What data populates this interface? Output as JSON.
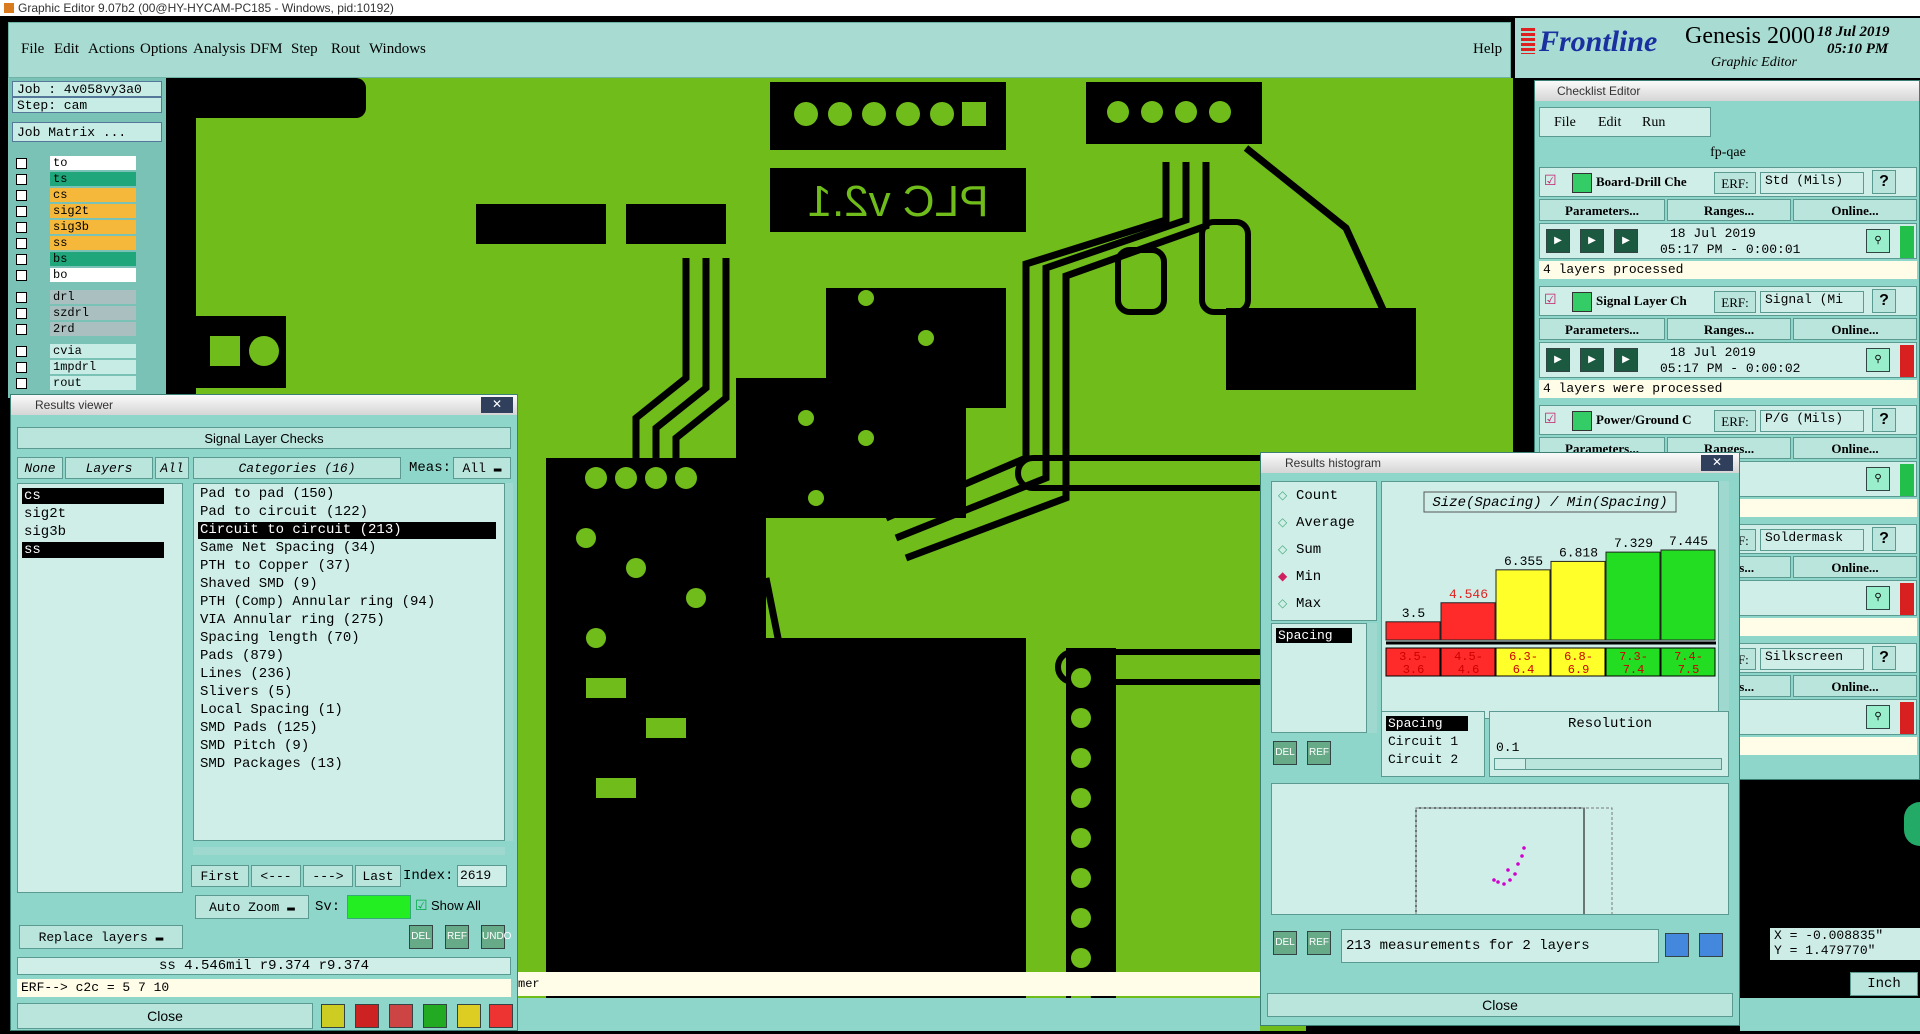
{
  "window_title": "Graphic Editor 9.07b2 (00@HY-HYCAM-PC185 - Windows, pid:10192)",
  "menu": [
    "File",
    "Edit",
    "Actions",
    "Options",
    "Analysis",
    "DFM",
    "Step",
    "Rout",
    "Windows"
  ],
  "help_label": "Help",
  "brand": {
    "logo": "Frontline",
    "product": "Genesis 2000",
    "subtitle": "Graphic Editor",
    "date": "18 Jul 2019",
    "time": "05:10 PM"
  },
  "job": {
    "job": "Job : 4v058vy3a0",
    "step": "Step: cam",
    "matrix": "Job Matrix ..."
  },
  "layers": [
    {
      "name": "to",
      "color": "#ffffff"
    },
    {
      "name": "ts",
      "color": "#1fa67a"
    },
    {
      "name": "cs",
      "color": "#f5b83a"
    },
    {
      "name": "sig2t",
      "color": "#f5b83a"
    },
    {
      "name": "sig3b",
      "color": "#f5b83a"
    },
    {
      "name": "ss",
      "color": "#f5b83a"
    },
    {
      "name": "bs",
      "color": "#1fa67a"
    },
    {
      "name": "bo",
      "color": "#ffffff"
    },
    {
      "name": "drl",
      "color": "#aac0c0"
    },
    {
      "name": "szdrl",
      "color": "#aac0c0"
    },
    {
      "name": "2rd",
      "color": "#aac0c0"
    },
    {
      "name": "cvia",
      "color": "#c6ece5"
    },
    {
      "name": "1mpdrl",
      "color": "#c6ece5"
    },
    {
      "name": "rout",
      "color": "#c6ece5"
    }
  ],
  "board_text": "PLC v2.1",
  "results_viewer": {
    "title": "Results viewer",
    "header": "Signal Layer Checks",
    "none": "None",
    "layers": "Layers",
    "all": "All",
    "categories_label": "Categories (16)",
    "meas_label": "Meas:",
    "meas_value": "All",
    "layer_list": [
      "cs",
      "sig2t",
      "sig3b",
      "ss"
    ],
    "categories": [
      "Pad to pad (150)",
      "Pad to circuit (122)",
      "Circuit to circuit (213)",
      "Same Net Spacing (34)",
      "PTH to Copper (37)",
      "Shaved SMD (9)",
      "PTH (Comp) Annular ring (94)",
      "VIA Annular ring (275)",
      "Spacing length (70)",
      "Pads (879)",
      "Lines (236)",
      "Slivers (5)",
      "Local Spacing (1)",
      "SMD Pads (125)",
      "SMD Pitch (9)",
      "SMD Packages (13)"
    ],
    "first": "First",
    "prev": "<---",
    "next": "--->",
    "last": "Last",
    "index_label": "Index:",
    "index_value": "2619",
    "auto_zoom": "Auto Zoom",
    "sv_label": "Sv:",
    "show_all": "Show All",
    "replace_layers": "Replace layers",
    "del": "DEL",
    "ref": "REF",
    "undo": "UNDO",
    "status": "ss 4.546mil  r9.374  r9.374",
    "erf": "ERF--> c2c = 5 7 10",
    "close": "Close"
  },
  "checklist": {
    "title": "Checklist Editor",
    "menu": [
      "File",
      "Edit",
      "Run"
    ],
    "name": "fp-qae",
    "param": "Parameters...",
    "ranges": "Ranges...",
    "online": "Online...",
    "erf": "ERF:",
    "items": [
      {
        "name": "Board-Drill Che",
        "erf": "Std (Mils)",
        "date": "18 Jul 2019",
        "time": "05:17 PM - 0:00:01",
        "status": "4 layers processed",
        "state": "#22c04a"
      },
      {
        "name": "Signal Layer Ch",
        "erf": "Signal (Mi",
        "date": "18 Jul 2019",
        "time": "05:17 PM - 0:00:02",
        "status": "4 layers were processed",
        "state": "#d82020"
      },
      {
        "name": "Power/Ground C",
        "erf": "P/G (Mils)",
        "date": "2019",
        "time": "0:00:01",
        "status": "processed",
        "state": "#22c04a"
      },
      {
        "name": "",
        "erf": "Soldermask",
        "date": "2019",
        "time": "0:00:01",
        "status": "ere processed",
        "state": "#d82020"
      },
      {
        "name": "",
        "erf": "Silkscreen",
        "date": "2019",
        "time": "0:00:02",
        "status": "rocessed",
        "state": "#d82020"
      }
    ]
  },
  "histogram": {
    "title": "Results histogram",
    "modes": [
      "Count",
      "Average",
      "Sum",
      "Min",
      "Max"
    ],
    "selected_mode": "Min",
    "list_item": "Spacing",
    "chart_title": "Size(Spacing) / Min(Spacing)",
    "resolution_label": "Resolution",
    "resolution_value": "0.1",
    "measure_list": [
      "Spacing",
      "Circuit 1",
      "Circuit 2"
    ],
    "summary": "213 measurements for 2 layers",
    "close": "Close",
    "del": "DEL",
    "ref": "REF"
  },
  "chart_data": {
    "type": "bar",
    "title": "Size(Spacing) / Min(Spacing)",
    "categories": [
      "3.5-3.6",
      "4.5-4.6",
      "6.3-6.4",
      "6.8-6.9",
      "7.3-7.4",
      "7.4-7.5"
    ],
    "values": [
      3.5,
      4.546,
      6.355,
      6.818,
      7.329,
      7.445
    ],
    "value_labels": [
      "3.5",
      "4.546",
      "6.355",
      "6.818",
      "7.329",
      "7.445"
    ],
    "colors": [
      "#ff2a2a",
      "#ff2a2a",
      "#ffff2a",
      "#ffff2a",
      "#22dd22",
      "#22dd22"
    ],
    "ylim": [
      0,
      8
    ]
  },
  "coords": {
    "x": "X = -0.008835\"",
    "y": "Y = 1.479770\""
  },
  "units": "Inch",
  "bottom_text": "mer"
}
